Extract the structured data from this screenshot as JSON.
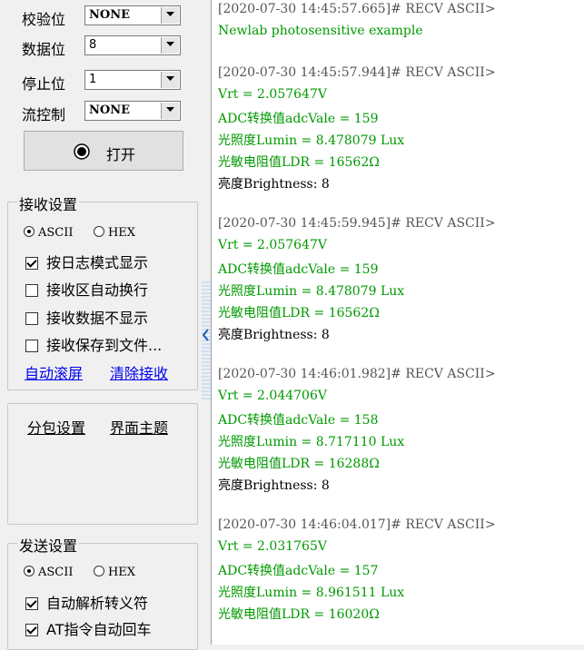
{
  "port_settings": {
    "parity": {
      "label": "校验位",
      "value": "NONE"
    },
    "databits": {
      "label": "数据位",
      "value": "8"
    },
    "stopbits": {
      "label": "停止位",
      "value": "1"
    },
    "flow": {
      "label": "流控制",
      "value": "NONE"
    },
    "open_button_label": "打开"
  },
  "receive_settings": {
    "title": "接收设置",
    "radio_ascii": "ASCII",
    "radio_hex": "HEX",
    "selected": "ASCII",
    "checks": [
      {
        "label": "按日志模式显示",
        "checked": true
      },
      {
        "label": "接收区自动换行",
        "checked": false
      },
      {
        "label": "接收数据不显示",
        "checked": false
      },
      {
        "label": "接收保存到文件...",
        "checked": false
      }
    ],
    "auto_scroll_link": "自动滚屏",
    "clear_link": "清除接收"
  },
  "tabs": {
    "packet_settings": "分包设置",
    "ui_theme": "界面主题"
  },
  "send_settings": {
    "title": "发送设置",
    "radio_ascii": "ASCII",
    "radio_hex": "HEX",
    "selected": "ASCII",
    "checks": [
      {
        "label": "自动解析转义符",
        "checked": true
      },
      {
        "label": "AT指令自动回车",
        "checked": true
      }
    ]
  },
  "receive_log": [
    {
      "style": "hdr",
      "text": "[2020-07-30 14:45:57.665]# RECV ASCII>"
    },
    {
      "style": "grn",
      "text": "Newlab photosensitive example"
    },
    {
      "style": "blank",
      "text": ""
    },
    {
      "style": "hdr",
      "text": "[2020-07-30 14:45:57.944]# RECV ASCII>"
    },
    {
      "style": "grn",
      "text": "Vrt = 2.057647V"
    },
    {
      "style": "grn",
      "text": "ADC转换值adcVale = 159"
    },
    {
      "style": "grn",
      "text": "光照度Lumin = 8.478079 Lux"
    },
    {
      "style": "grn",
      "text": "光敏电阻值LDR = 16562Ω"
    },
    {
      "style": "blk",
      "text": "亮度Brightness: 8"
    },
    {
      "style": "blank",
      "text": ""
    },
    {
      "style": "hdr",
      "text": "[2020-07-30 14:45:59.945]# RECV ASCII>"
    },
    {
      "style": "grn",
      "text": "Vrt = 2.057647V"
    },
    {
      "style": "grn",
      "text": "ADC转换值adcVale = 159"
    },
    {
      "style": "grn",
      "text": "光照度Lumin = 8.478079 Lux"
    },
    {
      "style": "grn",
      "text": "光敏电阻值LDR = 16562Ω"
    },
    {
      "style": "blk",
      "text": "亮度Brightness: 8"
    },
    {
      "style": "blank",
      "text": ""
    },
    {
      "style": "hdr",
      "text": "[2020-07-30 14:46:01.982]# RECV ASCII>"
    },
    {
      "style": "grn",
      "text": "Vrt = 2.044706V"
    },
    {
      "style": "grn",
      "text": "ADC转换值adcVale = 158"
    },
    {
      "style": "grn",
      "text": "光照度Lumin = 8.717110 Lux"
    },
    {
      "style": "grn",
      "text": "光敏电阻值LDR = 16288Ω"
    },
    {
      "style": "blk",
      "text": "亮度Brightness: 8"
    },
    {
      "style": "blank",
      "text": ""
    },
    {
      "style": "hdr",
      "text": "[2020-07-30 14:46:04.017]# RECV ASCII>"
    },
    {
      "style": "grn",
      "text": "Vrt = 2.031765V"
    },
    {
      "style": "grn",
      "text": "ADC转换值adcVale = 157"
    },
    {
      "style": "grn",
      "text": "光照度Lumin = 8.961511 Lux"
    },
    {
      "style": "grn",
      "text": "光敏电阻值LDR = 16020Ω"
    }
  ]
}
